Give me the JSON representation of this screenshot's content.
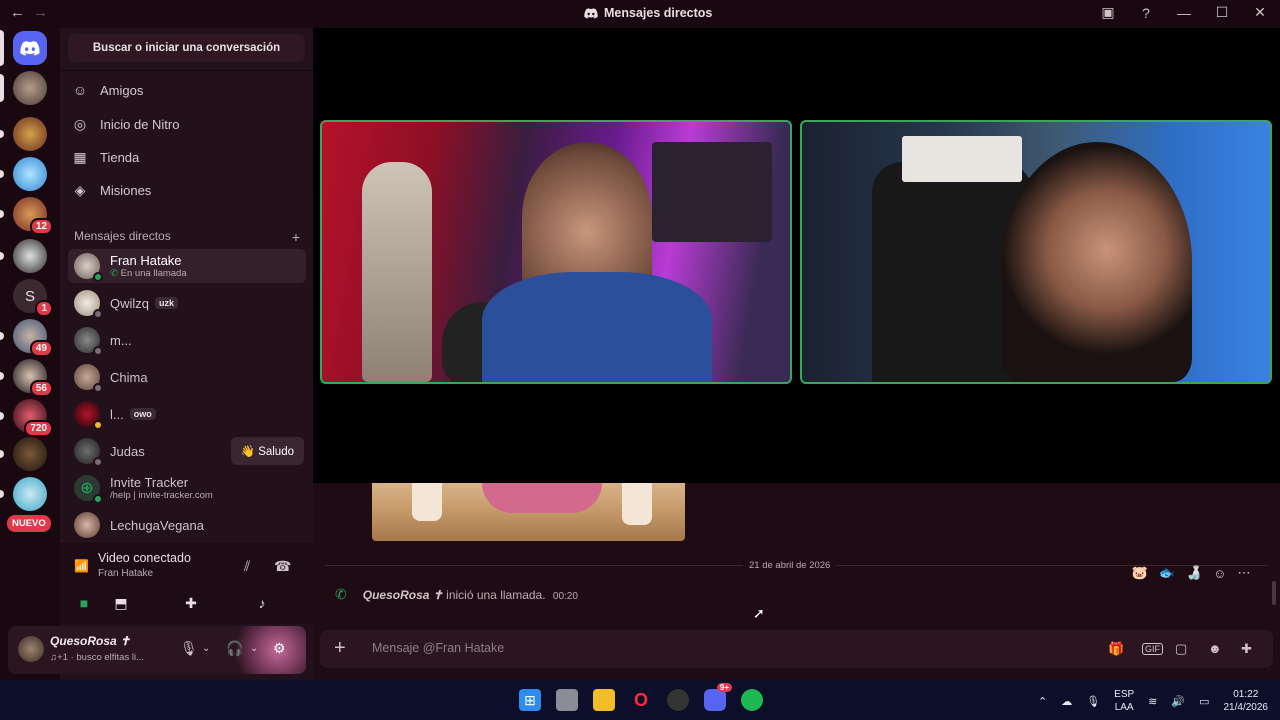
{
  "window": {
    "title": "Mensajes directos",
    "back_icon": "←",
    "forward_icon": "→"
  },
  "search": {
    "label": "Buscar o iniciar una conversación"
  },
  "nav": [
    {
      "label": "Amigos",
      "icon": "friends-icon"
    },
    {
      "label": "Inicio de Nitro",
      "icon": "nitro-icon"
    },
    {
      "label": "Tienda",
      "icon": "shop-icon"
    },
    {
      "label": "Misiones",
      "icon": "quests-icon"
    }
  ],
  "dm_section": {
    "title": "Mensajes directos",
    "add": "+"
  },
  "dms": [
    {
      "name": "Fran Hatake",
      "sub": "En una llamada",
      "active": true
    },
    {
      "name": "Qwilzq",
      "tag": "uzk"
    },
    {
      "name": "m..."
    },
    {
      "name": "Chima"
    },
    {
      "name": "l...",
      "tag": "owo"
    },
    {
      "name": "Judas",
      "action": "Saludo"
    },
    {
      "name": "Invite Tracker",
      "sub": "/help | invite-tracker.com"
    },
    {
      "name": "LechugaVegana"
    }
  ],
  "servers": [
    {
      "badge": ""
    },
    {
      "badge": ""
    },
    {
      "badge": ""
    },
    {
      "badge": ""
    },
    {
      "badge": "12"
    },
    {
      "badge": ""
    },
    {
      "badge": "1",
      "letter": "S"
    },
    {
      "badge": "49"
    },
    {
      "badge": "56"
    },
    {
      "badge": "720"
    },
    {
      "badge": ""
    },
    {
      "badge": ""
    }
  ],
  "server_new_label": "NUEVO",
  "voice": {
    "title": "Video conectado",
    "subtitle": "Fran Hatake"
  },
  "user": {
    "name": "QuesoRosa ✝",
    "status": "♫+1 · busco elfitas li..."
  },
  "chat": {
    "date_divider": "21 de abril de 2026",
    "call_user": "QuesoRosa ✝",
    "call_text": "inició una llamada.",
    "call_time": "00:20",
    "composer_placeholder": "Mensaje @Fran Hatake"
  },
  "taskbar": {
    "lang_top": "ESP",
    "lang_bottom": "LAA",
    "time": "01:22",
    "date": "21/4/2026",
    "discord_badge": "9+"
  },
  "colors": {
    "accent": "#5865f2",
    "online": "#23a55a",
    "badge": "#e1384a",
    "video_border": "#3ba55c"
  }
}
